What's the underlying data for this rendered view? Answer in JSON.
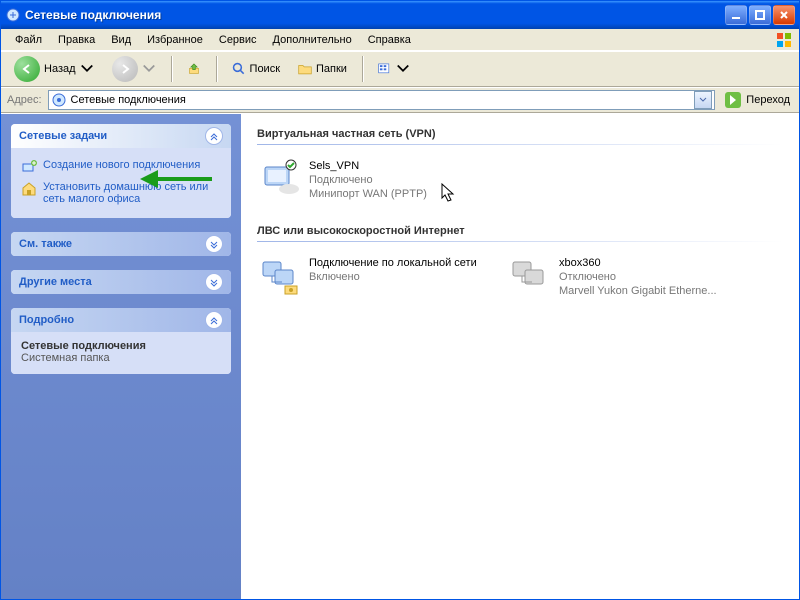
{
  "window": {
    "title": "Сетевые подключения"
  },
  "menu": {
    "file": "Файл",
    "edit": "Правка",
    "view": "Вид",
    "fav": "Избранное",
    "tools": "Сервис",
    "adv": "Дополнительно",
    "help": "Справка"
  },
  "toolbar": {
    "back": "Назад",
    "search": "Поиск",
    "folders": "Папки"
  },
  "address": {
    "label": "Адрес:",
    "value": "Сетевые подключения",
    "go": "Переход"
  },
  "sidebar": {
    "tasks_title": "Сетевые задачи",
    "task_new": "Создание нового подключения",
    "task_home": "Установить домашнюю сеть или сеть малого офиса",
    "see_also": "См. также",
    "other_places": "Другие места",
    "details_title": "Подробно",
    "details_name": "Сетевые подключения",
    "details_type": "Системная папка"
  },
  "groups": {
    "vpn": "Виртуальная частная сеть (VPN)",
    "lan": "ЛВС или высокоскоростной Интернет"
  },
  "connections": {
    "vpn1": {
      "name": "Sels_VPN",
      "status": "Подключено",
      "device": "Минипорт WAN (PPTP)"
    },
    "lan1": {
      "name": "Подключение по локальной сети",
      "status": "Включено",
      "device": ""
    },
    "lan2": {
      "name": "xbox360",
      "status": "Отключено",
      "device": "Marvell Yukon Gigabit Etherne..."
    }
  }
}
